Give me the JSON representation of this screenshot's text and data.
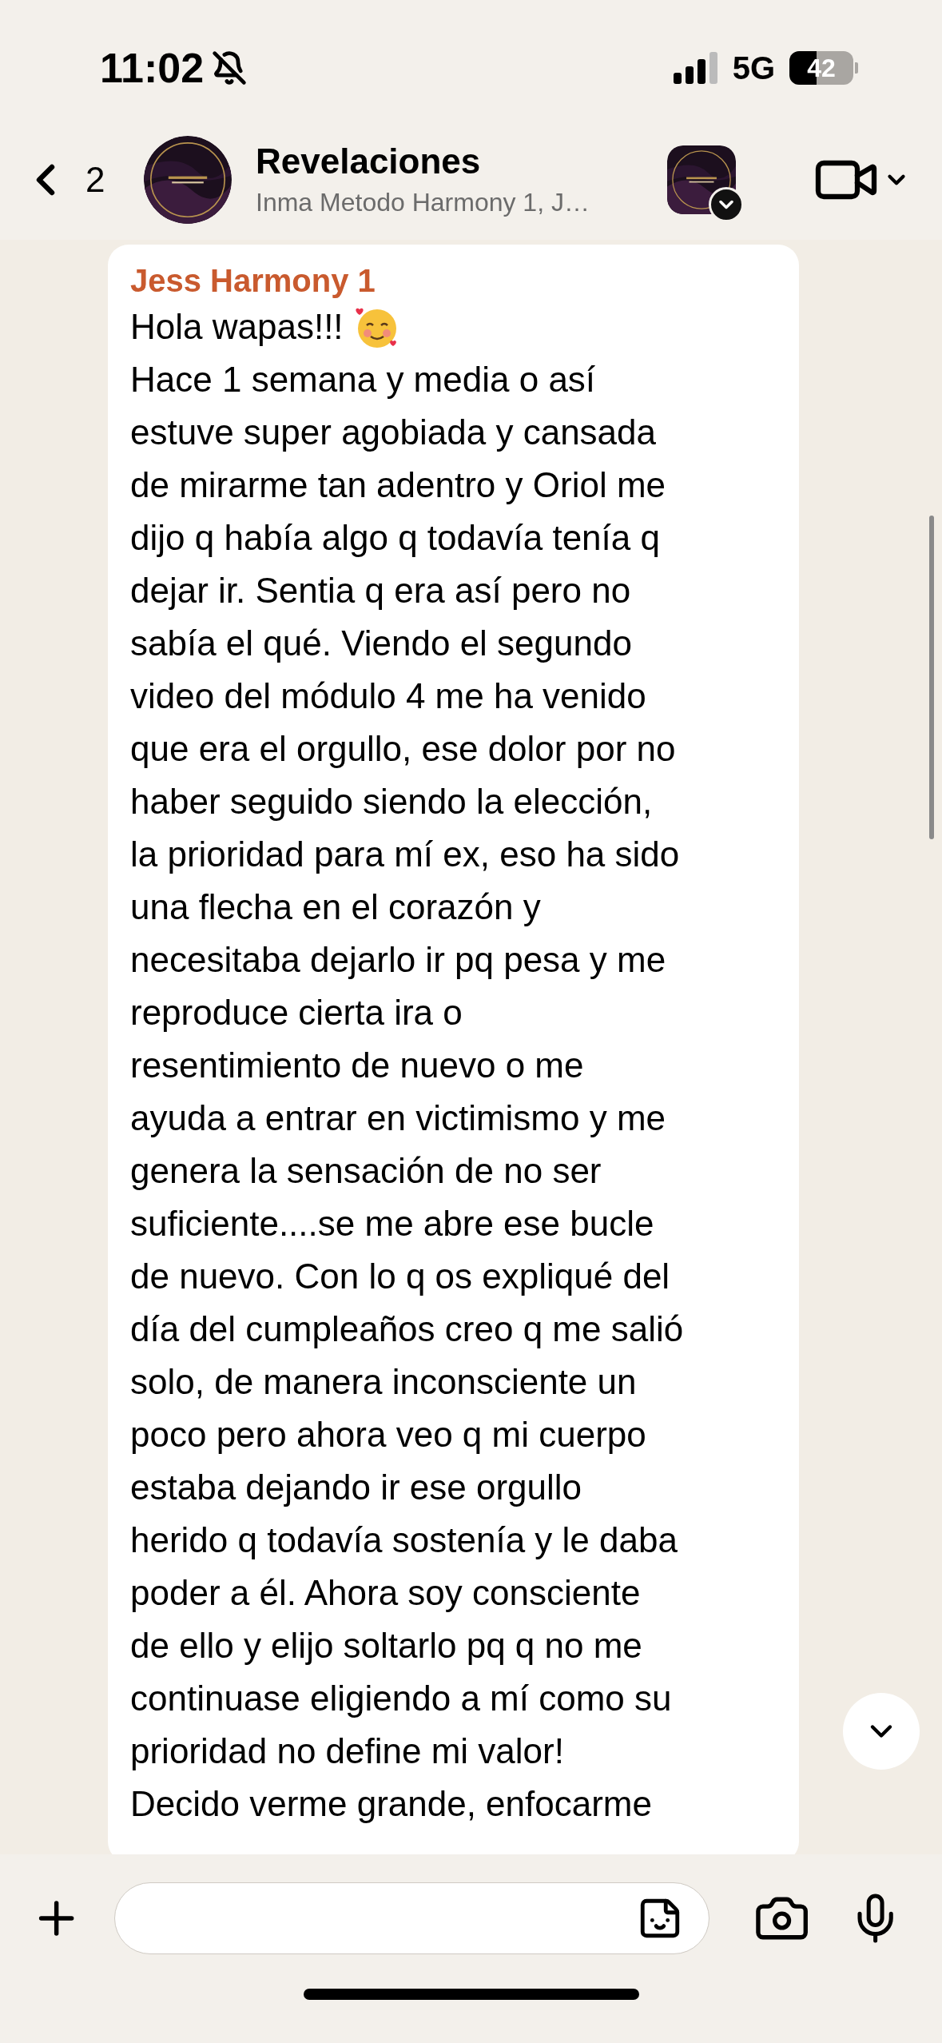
{
  "status_bar": {
    "time": "11:02",
    "network": "5G",
    "battery": "42"
  },
  "header": {
    "back_count": "2",
    "title": "Revelaciones",
    "subtitle": "Inma Metodo Harmony 1, J…"
  },
  "message": {
    "sender": "Jess Harmony 1",
    "greeting": "Hola wapas!!!",
    "lines": [
      "Hace 1 semana y media o así",
      "estuve super agobiada y cansada",
      "de mirarme tan adentro y Oriol me",
      "dijo q había algo q todavía tenía q",
      "dejar ir. Sentia q era así pero no",
      "sabía el qué. Viendo el segundo",
      "video del módulo 4 me ha venido",
      "que era el orgullo, ese dolor por no",
      "haber seguido siendo la elección,",
      "la prioridad para mí ex, eso ha sido",
      "una flecha en el corazón y",
      "necesitaba dejarlo ir pq pesa y me",
      "reproduce cierta ira o",
      "resentimiento de nuevo o me",
      "ayuda a entrar en victimismo y me",
      "genera la sensación de no ser",
      "suficiente....se me abre ese bucle",
      "de nuevo. Con lo q os expliqué del",
      "día del cumpleaños creo q me salió",
      "solo, de manera inconsciente un",
      "poco pero ahora veo q mi cuerpo",
      "estaba dejando ir ese orgullo",
      "herido q todavía sostenía y le daba",
      "poder a él. Ahora soy consciente",
      "de ello y elijo soltarlo pq q no me",
      "continuase eligiendo a mí como su",
      "prioridad no define mi valor!",
      "Decido verme grande, enfocarme"
    ]
  }
}
